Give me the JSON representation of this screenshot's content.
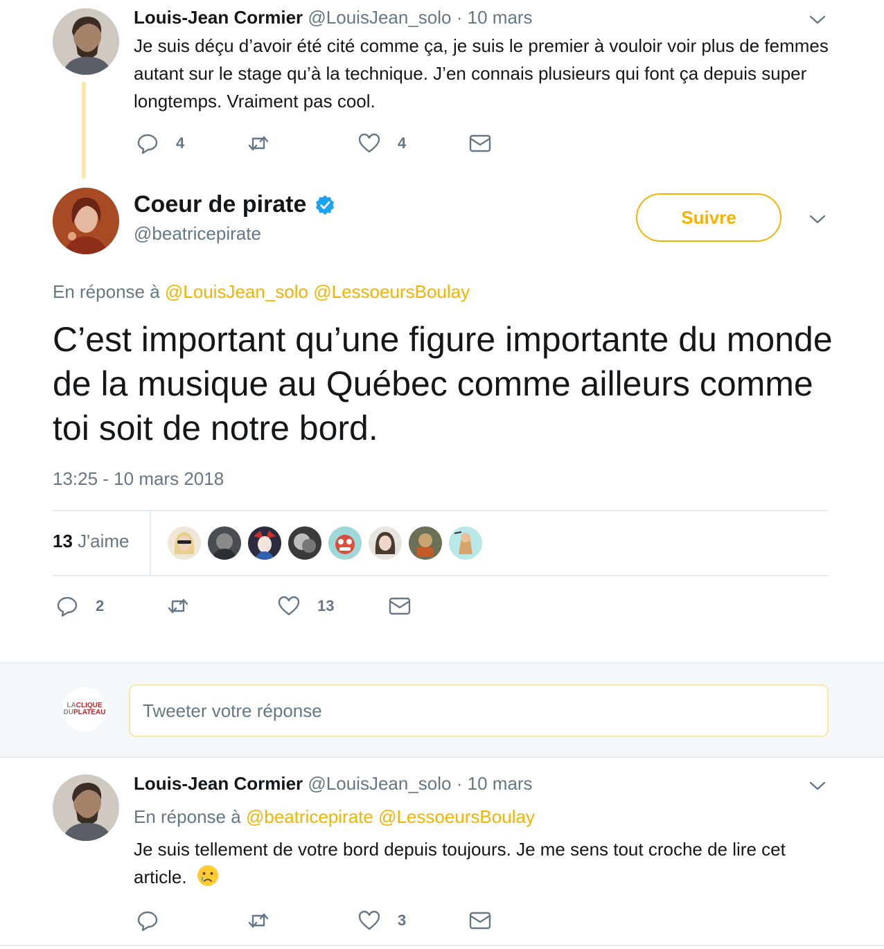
{
  "tweet1": {
    "name": "Louis-Jean Cormier",
    "handle": "@LouisJean_solo",
    "separator": "·",
    "date": "10 mars",
    "text": "Je suis déçu d’avoir été cité comme ça, je suis le premier à vouloir voir plus de femmes autant sur le stage qu’à la technique. J’en connais plusieurs qui font ça depuis super longtemps. Vraiment pas cool.",
    "reply_count": "4",
    "like_count": "4"
  },
  "main_tweet": {
    "name": "Coeur de pirate",
    "handle": "@beatricepirate",
    "follow_label": "Suivre",
    "reply_to_label": "En réponse à",
    "reply_to_mentions": [
      "@LouisJean_solo",
      "@LessoeursBoulay"
    ],
    "text": "C’est important qu’une figure importante du monde de la musique au Québec comme ailleurs comme toi soit de notre bord.",
    "timestamp": "13:25 - 10 mars 2018",
    "likes_count": "13",
    "likes_label": "J'aime",
    "reply_count": "2",
    "like_count": "13"
  },
  "reply_box": {
    "placeholder": "Tweeter votre réponse",
    "avatar_line1_a": "LA",
    "avatar_line1_b": "CLIQUE",
    "avatar_line2_a": "DU",
    "avatar_line2_b": "PLATEAU"
  },
  "tweet3": {
    "name": "Louis-Jean Cormier",
    "handle": "@LouisJean_solo",
    "separator": "·",
    "date": "10 mars",
    "reply_to_label": "En réponse à",
    "reply_to_mentions": [
      "@beatricepirate",
      "@LessoeursBoulay"
    ],
    "text": "Je suis tellement de votre bord depuis toujours. Je me sens tout croche de lire cet article.",
    "like_count": "3"
  },
  "colors": {
    "accent": "#f5b300",
    "muted": "#657786",
    "text": "#14171a",
    "verified": "#1da1f2",
    "thread_line": "#fbe7a6"
  },
  "icons": [
    "reply-icon",
    "retweet-icon",
    "like-icon",
    "dm-icon",
    "chevron-down-icon",
    "verified-icon",
    "crying-emoji-icon"
  ]
}
